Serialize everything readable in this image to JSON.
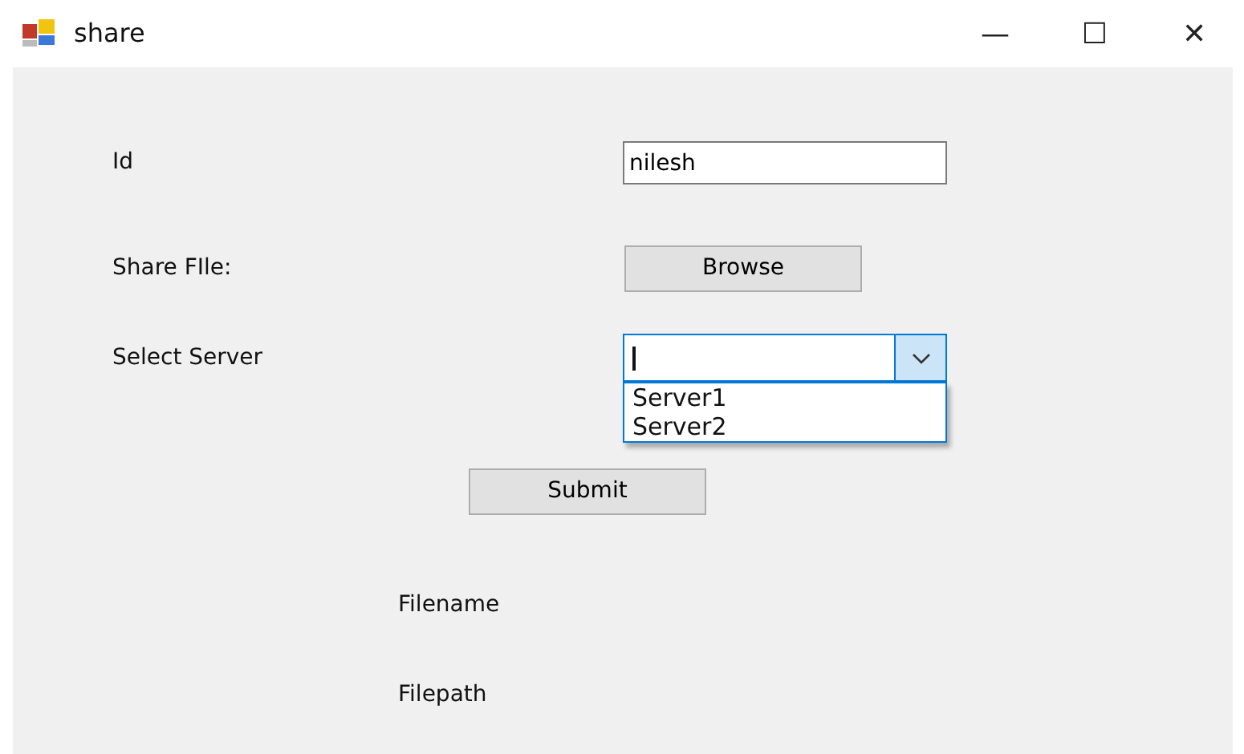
{
  "window": {
    "title": "share",
    "controls": [
      "—",
      "☐",
      "✕"
    ]
  },
  "id_row": {
    "label": "Id",
    "value": "nilesh"
  },
  "file_row": {
    "label": "Share FIle:",
    "button": "Browse"
  },
  "server_row": {
    "label": "Select Server",
    "expanded": true,
    "options": [
      {
        "label": "Server1",
        "selected": false
      },
      {
        "label": "Server2",
        "selected": false
      }
    ]
  },
  "submit": "Submit",
  "labels": [
    "Filename",
    "Filepath"
  ]
}
